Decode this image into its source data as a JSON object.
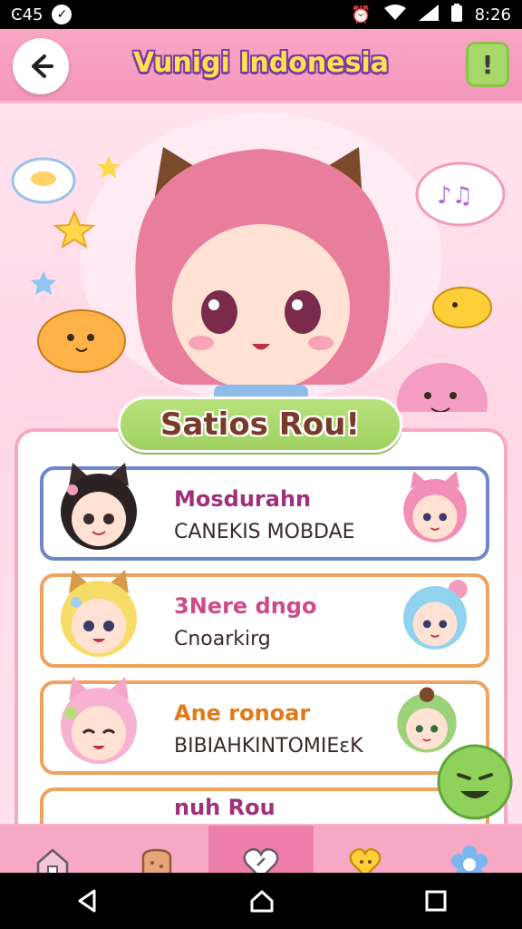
{
  "status_bar": {
    "left_time": "Ͼ45",
    "right_time": "8:26"
  },
  "header": {
    "title": "Vunigi Indonesia",
    "info_label": "!"
  },
  "hero": {
    "banner": "Satios Rou!"
  },
  "cards": [
    {
      "title": "Mosdurahn",
      "subtitle": "CANEKIS MOBDAE",
      "border": "#6f86c9",
      "title_color": "#a0307a"
    },
    {
      "title": "3Nere dngo",
      "subtitle": "Cnoarkirg",
      "border": "#f0a35e",
      "title_color": "#d04a8a"
    },
    {
      "title": "Ane ronoar",
      "subtitle": "BIBIAHKINTOMIEɛK",
      "border": "#f0a35e",
      "title_color": "#e07a1a"
    },
    {
      "title": "nuh Rou"
    }
  ],
  "bottom_nav": [
    {
      "icon": "home-icon"
    },
    {
      "icon": "bread-icon"
    },
    {
      "icon": "heart-icon",
      "active": true
    },
    {
      "icon": "chat-icon"
    },
    {
      "icon": "flower-icon"
    }
  ],
  "colors": {
    "header": "#f7a0c1",
    "accent_green": "#a8d86a",
    "panel_border": "#f4a9c6"
  }
}
